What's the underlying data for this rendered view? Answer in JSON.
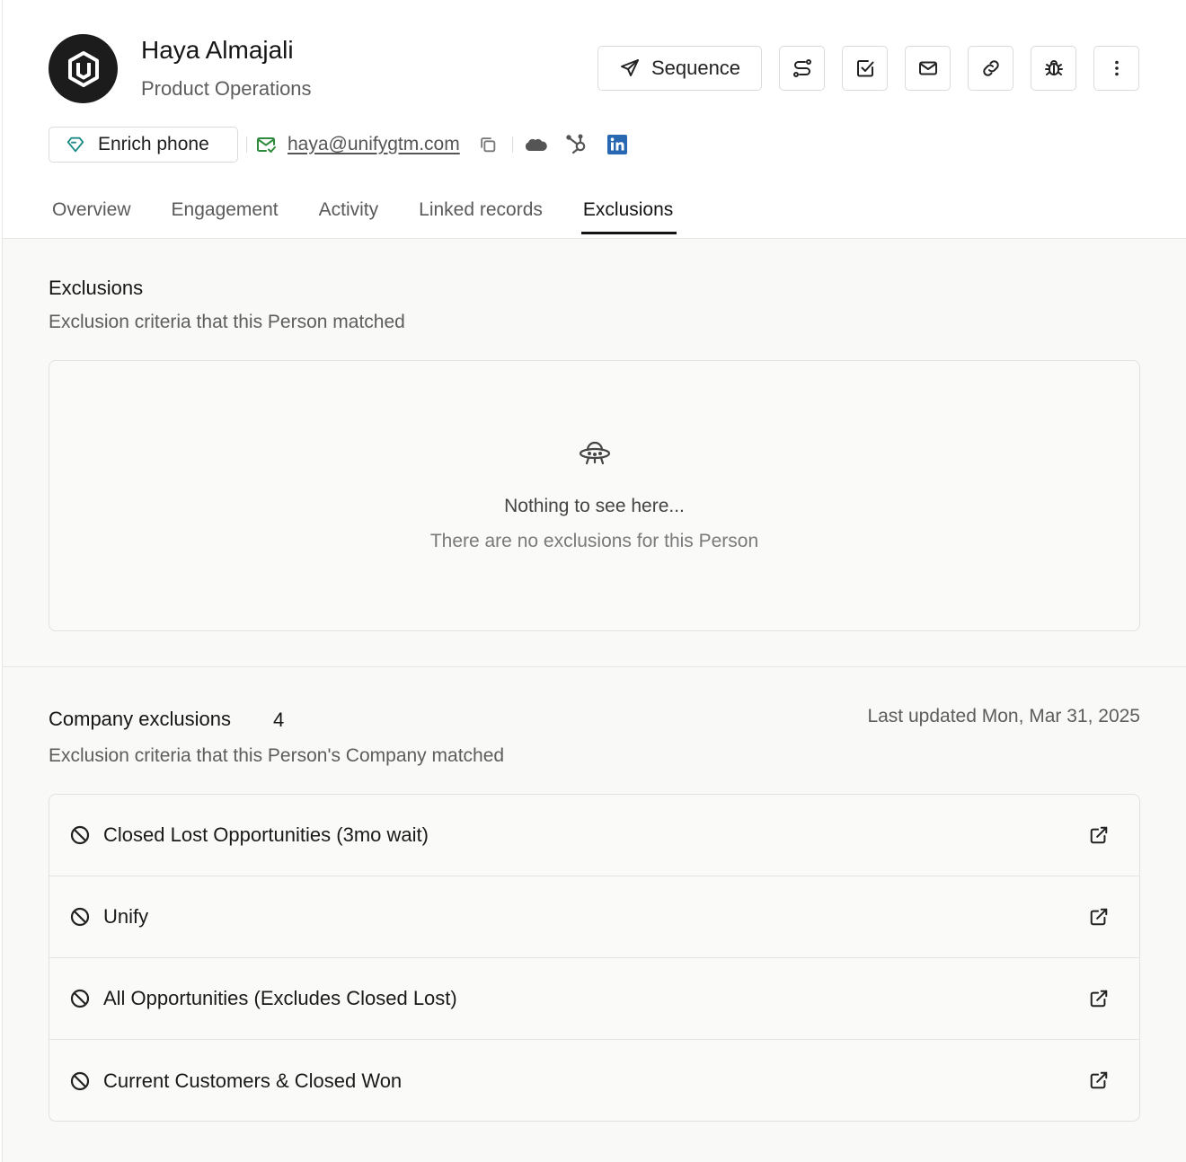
{
  "person": {
    "name": "Haya Almajali",
    "role": "Product Operations",
    "email": "haya@unifygtm.com"
  },
  "actions": {
    "sequence_label": "Sequence",
    "icons": [
      "route-icon",
      "task-check-icon",
      "mail-icon",
      "link-icon",
      "bug-icon",
      "more-vertical-icon"
    ]
  },
  "contact": {
    "enrich_label": "Enrich phone"
  },
  "tabs": [
    {
      "label": "Overview"
    },
    {
      "label": "Engagement"
    },
    {
      "label": "Activity"
    },
    {
      "label": "Linked records"
    },
    {
      "label": "Exclusions",
      "active": true
    }
  ],
  "exclusions": {
    "title": "Exclusions",
    "subtitle": "Exclusion criteria that this Person matched",
    "empty_title": "Nothing to see here...",
    "empty_subtitle": "There are no exclusions for this Person"
  },
  "company_exclusions": {
    "title": "Company exclusions",
    "count": "4",
    "last_updated": "Last updated Mon, Mar 31, 2025",
    "subtitle": "Exclusion criteria that this Person's Company matched",
    "items": [
      {
        "label": "Closed Lost Opportunities (3mo wait)"
      },
      {
        "label": "Unify"
      },
      {
        "label": "All Opportunities (Excludes Closed Lost)"
      },
      {
        "label": "Current Customers & Closed Won"
      }
    ]
  },
  "colors": {
    "accent_text": "#141414",
    "email_icon_green": "#2e8b3e",
    "diamond_teal": "#1e8a86",
    "linkedin_blue": "#2867b2"
  }
}
